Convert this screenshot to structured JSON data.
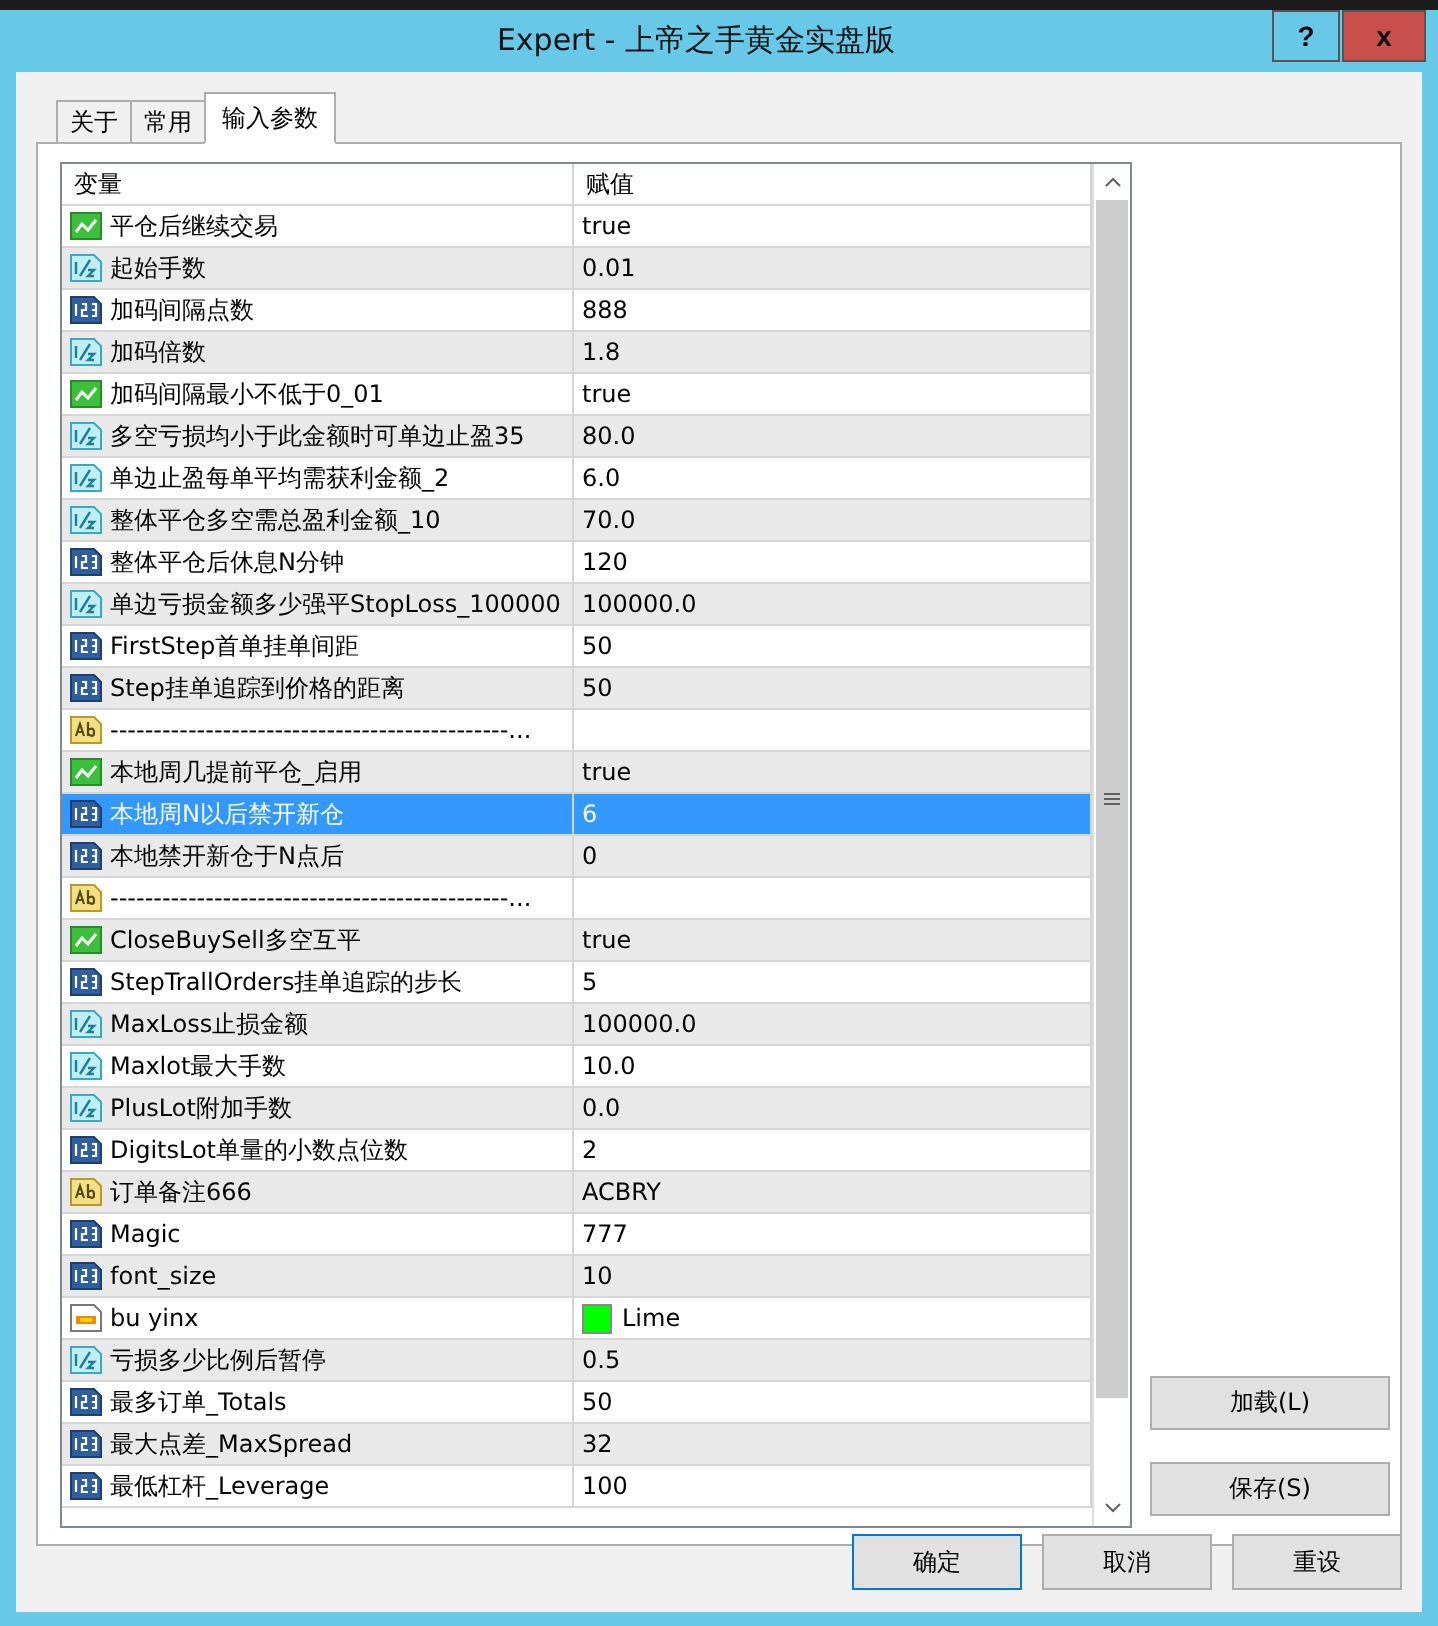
{
  "window": {
    "title": "Expert - 上帝之手黄金实盘版",
    "help_button": "?",
    "close_button": "x"
  },
  "tabs": [
    {
      "label": "关于",
      "selected": false
    },
    {
      "label": "常用",
      "selected": false
    },
    {
      "label": "输入参数",
      "selected": true
    }
  ],
  "table": {
    "columns": [
      "变量",
      "赋值"
    ],
    "rows": [
      {
        "kind": "bool",
        "name": "平仓后继续交易",
        "value": "true",
        "selected": false
      },
      {
        "kind": "double",
        "name": "起始手数",
        "value": "0.01",
        "selected": false
      },
      {
        "kind": "int",
        "name": "加码间隔点数",
        "value": "888",
        "selected": false
      },
      {
        "kind": "double",
        "name": "加码倍数",
        "value": "1.8",
        "selected": false
      },
      {
        "kind": "bool",
        "name": "加码间隔最小不低于0_01",
        "value": "true",
        "selected": false
      },
      {
        "kind": "double",
        "name": "多空亏损均小于此金额时可单边止盈35",
        "value": "80.0",
        "selected": false
      },
      {
        "kind": "double",
        "name": "单边止盈每单平均需获利金额_2",
        "value": "6.0",
        "selected": false
      },
      {
        "kind": "double",
        "name": "整体平仓多空需总盈利金额_10",
        "value": "70.0",
        "selected": false
      },
      {
        "kind": "int",
        "name": "整体平仓后休息N分钟",
        "value": "120",
        "selected": false
      },
      {
        "kind": "double",
        "name": "单边亏损金额多少强平StopLoss_100000",
        "value": "100000.0",
        "selected": false
      },
      {
        "kind": "int",
        "name": "FirstStep首单挂单间距",
        "value": "50",
        "selected": false
      },
      {
        "kind": "int",
        "name": "Step挂单追踪到价格的距离",
        "value": "50",
        "selected": false
      },
      {
        "kind": "string",
        "name": "----------------------------------------------...",
        "value": "",
        "selected": false
      },
      {
        "kind": "bool",
        "name": "本地周几提前平仓_启用",
        "value": "true",
        "selected": false
      },
      {
        "kind": "int",
        "name": "本地周N以后禁开新仓",
        "value": "6",
        "selected": true
      },
      {
        "kind": "int",
        "name": "本地禁开新仓于N点后",
        "value": "0",
        "selected": false
      },
      {
        "kind": "string",
        "name": "----------------------------------------------...",
        "value": "",
        "selected": false
      },
      {
        "kind": "bool",
        "name": "CloseBuySell多空互平",
        "value": "true",
        "selected": false
      },
      {
        "kind": "int",
        "name": "StepTrallOrders挂单追踪的步长",
        "value": "5",
        "selected": false
      },
      {
        "kind": "double",
        "name": "MaxLoss止损金额",
        "value": "100000.0",
        "selected": false
      },
      {
        "kind": "double",
        "name": "Maxlot最大手数",
        "value": "10.0",
        "selected": false
      },
      {
        "kind": "double",
        "name": "PlusLot附加手数",
        "value": "0.0",
        "selected": false
      },
      {
        "kind": "int",
        "name": "DigitsLot单量的小数点位数",
        "value": "2",
        "selected": false
      },
      {
        "kind": "string",
        "name": "订单备注666",
        "value": "ACBRY",
        "selected": false
      },
      {
        "kind": "int",
        "name": "Magic",
        "value": "777",
        "selected": false
      },
      {
        "kind": "int",
        "name": "font_size",
        "value": "10",
        "selected": false
      },
      {
        "kind": "color",
        "name": "bu yinx",
        "value": "Lime",
        "color": "#00ff00",
        "selected": false
      },
      {
        "kind": "double",
        "name": "亏损多少比例后暂停",
        "value": "0.5",
        "selected": false
      },
      {
        "kind": "int",
        "name": "最多订单_Totals",
        "value": "50",
        "selected": false
      },
      {
        "kind": "int",
        "name": "最大点差_MaxSpread",
        "value": "32",
        "selected": false
      },
      {
        "kind": "int",
        "name": "最低杠杆_Leverage",
        "value": "100",
        "selected": false
      }
    ]
  },
  "side_buttons": [
    "加载(L)",
    "保存(S)"
  ],
  "buttons": [
    {
      "label": "确定",
      "default": true
    },
    {
      "label": "取消",
      "default": false
    },
    {
      "label": "重设",
      "default": false
    }
  ]
}
